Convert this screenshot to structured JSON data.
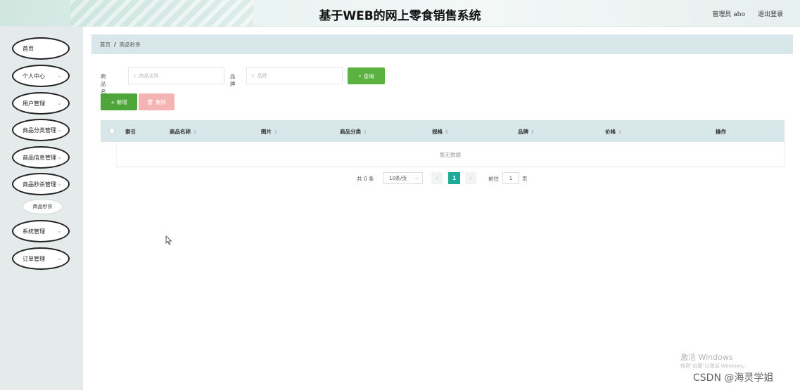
{
  "header": {
    "title": "基于WEB的网上零食销售系统",
    "user": "管理员 abo",
    "logout": "退出登录"
  },
  "sidebar": {
    "items": [
      {
        "label": "首页",
        "has_chevron": false
      },
      {
        "label": "个人中心",
        "has_chevron": true
      },
      {
        "label": "用户管理",
        "has_chevron": true
      },
      {
        "label": "商品分类管理",
        "has_chevron": true
      },
      {
        "label": "商品信息管理",
        "has_chevron": true
      },
      {
        "label": "商品秒杀管理",
        "has_chevron": true
      },
      {
        "label": "系统管理",
        "has_chevron": true
      },
      {
        "label": "订单管理",
        "has_chevron": true
      }
    ],
    "sub_item": "商品秒杀"
  },
  "breadcrumb": {
    "home": "首页",
    "separator": "/",
    "current": "商品秒杀"
  },
  "search": {
    "name_label": "商品名称",
    "name_placeholder": "商品名称",
    "brand_label": "品牌",
    "brand_placeholder": "品牌",
    "query_button": "查询",
    "search_icon": "search-icon"
  },
  "actions": {
    "add_label": "+ 新增",
    "delete_label": "删除"
  },
  "table": {
    "columns": [
      "索引",
      "商品名称",
      "图片",
      "商品分类",
      "规格",
      "品牌",
      "价格",
      "操作"
    ],
    "sortable": [
      false,
      true,
      true,
      true,
      true,
      true,
      true,
      false
    ],
    "empty_text": "暂无数据"
  },
  "pagination": {
    "total": "共 0 条",
    "page_size": "10条/页",
    "prev": "‹",
    "current": "1",
    "next": "›",
    "goto_label": "前往",
    "goto_value": "1",
    "page_unit": "页"
  },
  "os_overlay": {
    "activate_title": "激活 Windows",
    "activate_hint": "转到\"设置\"以激活 Windows。",
    "csdn": "CSDN @海灵学姐"
  },
  "colors": {
    "accent_green": "#5cb240",
    "add_green": "#4ea63a",
    "delete_pink": "#f5b3b3",
    "table_header": "#d7e7ea",
    "page_active": "#1bab9a"
  }
}
